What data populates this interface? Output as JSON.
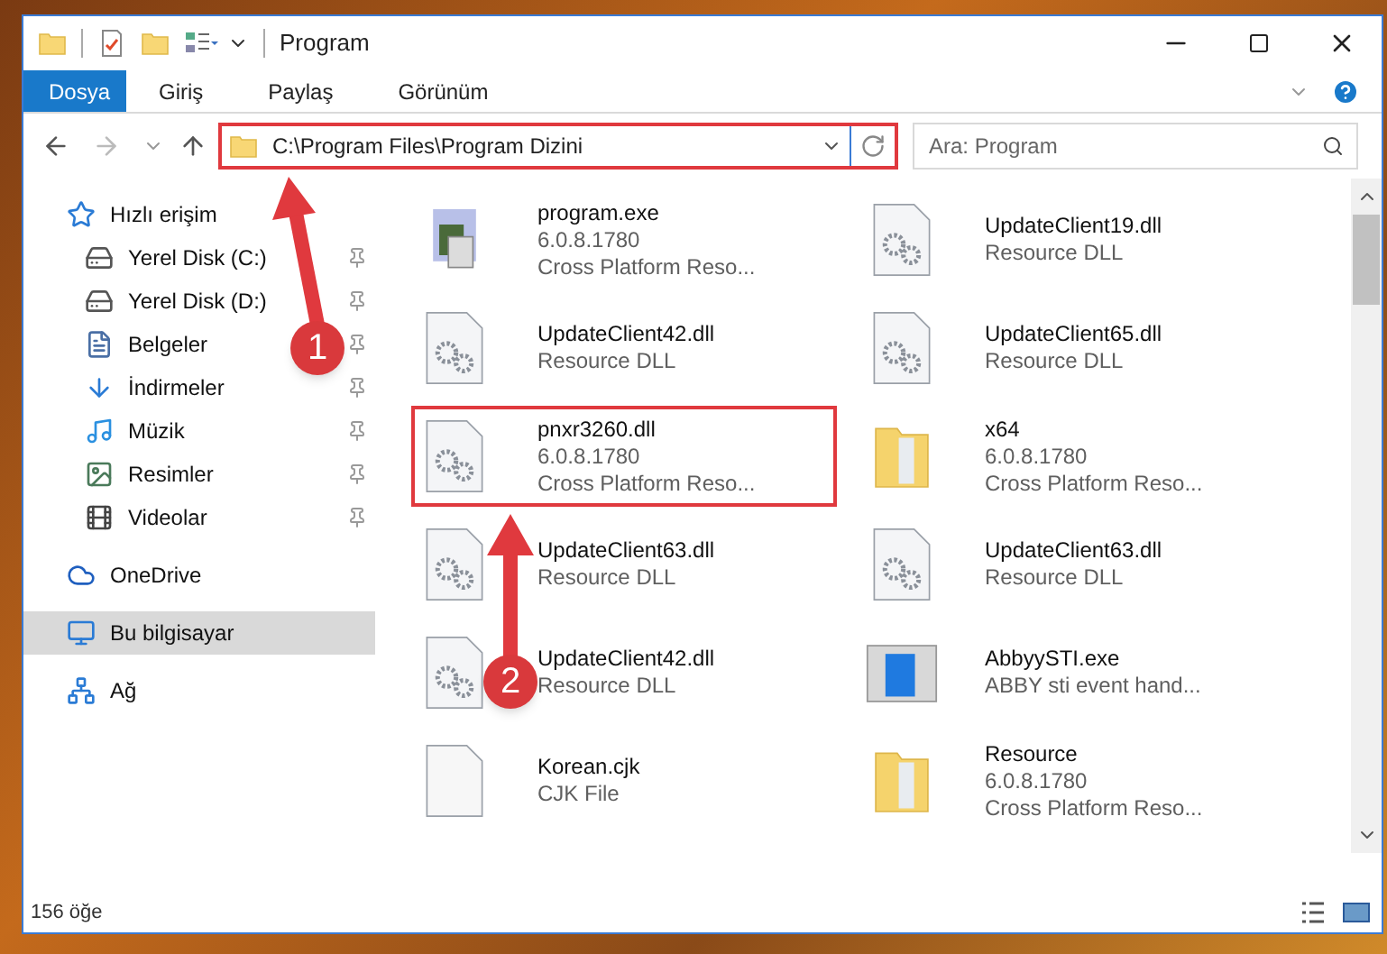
{
  "window": {
    "title": "Program"
  },
  "ribbon_tabs": [
    {
      "label": "Dosya",
      "selected": true
    },
    {
      "label": "Giriş",
      "selected": false
    },
    {
      "label": "Paylaş",
      "selected": false
    },
    {
      "label": "Görünüm",
      "selected": false
    }
  ],
  "address": {
    "path": "C:\\Program Files\\Program Dizini",
    "highlighted": true
  },
  "search": {
    "placeholder": "Ara: Program"
  },
  "nav": [
    {
      "label": "Hızlı erişim",
      "kind": "quick",
      "selected": false,
      "children": [
        {
          "label": "Yerel Disk (C:)",
          "kind": "disk-c",
          "pinned": true
        },
        {
          "label": "Yerel Disk (D:)",
          "kind": "disk",
          "pinned": true
        },
        {
          "label": "Belgeler",
          "kind": "docs",
          "pinned": true
        },
        {
          "label": "İndirmeler",
          "kind": "downloads",
          "pinned": true
        },
        {
          "label": "Müzik",
          "kind": "music",
          "pinned": true
        },
        {
          "label": "Resimler",
          "kind": "pictures",
          "pinned": true
        },
        {
          "label": "Videolar",
          "kind": "videos",
          "pinned": true
        }
      ]
    },
    {
      "label": "OneDrive",
      "kind": "cloud",
      "selected": false
    },
    {
      "label": "Bu bilgisayar",
      "kind": "pc",
      "selected": true
    },
    {
      "label": "Ağ",
      "kind": "network",
      "selected": false
    }
  ],
  "files": [
    {
      "name": "program.exe",
      "kind": "exe",
      "lines": [
        "6.0.8.1780",
        "Cross Platform Reso..."
      ],
      "highlighted": false
    },
    {
      "name": "UpdateClient19.dll",
      "kind": "dll",
      "lines": [
        "Resource DLL"
      ],
      "highlighted": false
    },
    {
      "name": "UpdateClient42.dll",
      "kind": "dll",
      "lines": [
        "Resource DLL"
      ],
      "highlighted": false
    },
    {
      "name": "UpdateClient65.dll",
      "kind": "dll",
      "lines": [
        "Resource DLL"
      ],
      "highlighted": false
    },
    {
      "name": "pnxr3260.dll",
      "kind": "dll",
      "lines": [
        "6.0.8.1780",
        "Cross Platform Reso..."
      ],
      "highlighted": true
    },
    {
      "name": "x64",
      "kind": "folder",
      "lines": [
        "6.0.8.1780",
        "Cross Platform Reso..."
      ],
      "highlighted": false
    },
    {
      "name": "UpdateClient63.dll",
      "kind": "dll",
      "lines": [
        "Resource DLL"
      ],
      "highlighted": false
    },
    {
      "name": "UpdateClient63.dll",
      "kind": "dll",
      "lines": [
        "Resource DLL"
      ],
      "highlighted": false
    },
    {
      "name": "UpdateClient42.dll",
      "kind": "dll",
      "lines": [
        "Resource DLL"
      ],
      "highlighted": false
    },
    {
      "name": "AbbyySTI.exe",
      "kind": "app",
      "lines": [
        "ABBY sti event hand..."
      ],
      "highlighted": false
    },
    {
      "name": "Korean.cjk",
      "kind": "file",
      "lines": [
        "CJK File"
      ],
      "highlighted": false
    },
    {
      "name": "Resource",
      "kind": "folder",
      "lines": [
        "6.0.8.1780",
        "Cross Platform Reso..."
      ],
      "highlighted": false
    }
  ],
  "status_bar": {
    "count": "156 öğe"
  },
  "annotations": [
    {
      "number": "1"
    },
    {
      "number": "2"
    }
  ]
}
